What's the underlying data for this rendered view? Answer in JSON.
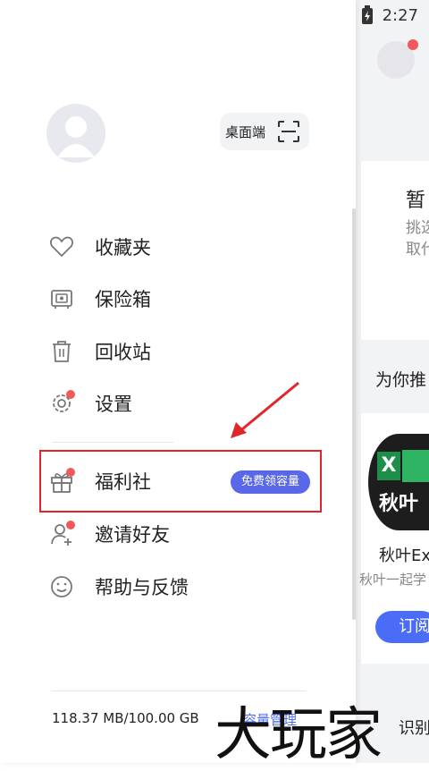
{
  "status_bar": {
    "time": "2:27",
    "icons": [
      "wifi-icon",
      "no-signal-icon",
      "battery-charging-icon"
    ]
  },
  "drawer": {
    "desktop_button_label": "桌面端",
    "menu": [
      {
        "label": "收藏夹",
        "icon": "heart-icon"
      },
      {
        "label": "保险箱",
        "icon": "safe-icon"
      },
      {
        "label": "回收站",
        "icon": "trash-icon"
      },
      {
        "label": "设置",
        "icon": "gear-icon"
      },
      {
        "label": "福利社",
        "icon": "gift-icon",
        "badge": "免费领容量"
      },
      {
        "label": "邀请好友",
        "icon": "add-user-icon"
      },
      {
        "label": "帮助与反馈",
        "icon": "smile-icon"
      }
    ],
    "storage": {
      "text": "118.37 MB/100.00 GB",
      "link": "容量管理"
    }
  },
  "background": {
    "title_partial": "暂",
    "sub1_partial": "挑选",
    "sub2_partial": "取代",
    "recommend_partial": "为你推",
    "app_logo_letter": "X",
    "app_logo_text": "秋叶",
    "app_name_partial": "秋叶Ex",
    "app_desc_partial": "秋叶一起学",
    "subscribe_partial": "订阅",
    "bottom_partial": "识别"
  },
  "watermark": "大玩家",
  "colors": {
    "accent": "#4a6cf7",
    "badge": "#5868e8",
    "red_dot": "#f05a5a",
    "highlight": "#e0262b"
  }
}
